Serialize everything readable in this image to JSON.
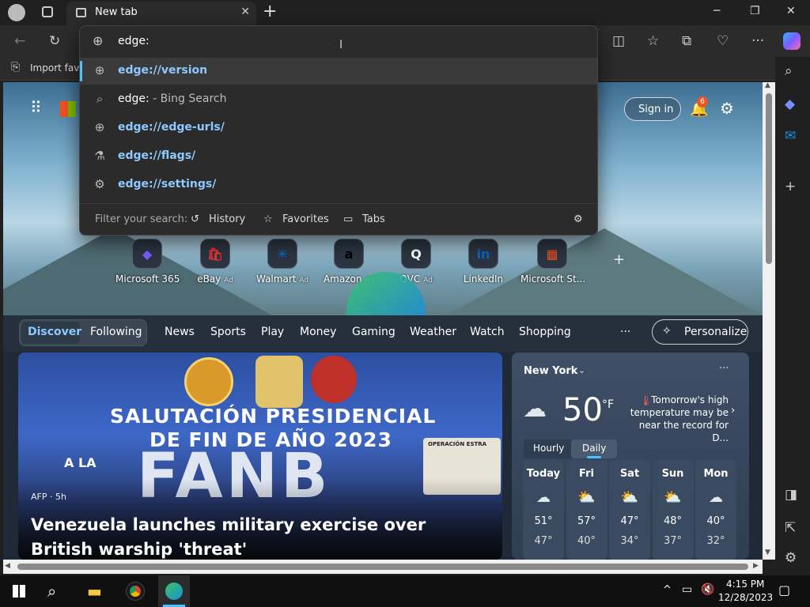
{
  "window": {
    "tab_title": "New tab",
    "minimize": "─",
    "restore": "❐",
    "close": "✕"
  },
  "toolbar": {
    "address_value": "edge:"
  },
  "favorites_bar": {
    "import_label": "Import favo"
  },
  "omnibox": {
    "suggestions": [
      {
        "icon": "globe-icon",
        "text": "edge://version",
        "kind": "link"
      },
      {
        "icon": "search-icon",
        "text": "edge:",
        "suffix": " - Bing Search",
        "kind": "search"
      },
      {
        "icon": "globe-icon",
        "text": "edge://edge-urls/",
        "kind": "link"
      },
      {
        "icon": "flask-icon",
        "text": "edge://flags/",
        "kind": "link"
      },
      {
        "icon": "gear-icon",
        "text": "edge://settings/",
        "kind": "link"
      }
    ],
    "filter_label": "Filter your search:",
    "filters": [
      "History",
      "Favorites",
      "Tabs"
    ]
  },
  "ntp": {
    "sign_in": "Sign in",
    "notifications_count": "6",
    "quick_links": [
      {
        "name": "Microsoft 365",
        "ad": "",
        "glyph": "◆",
        "color": "#7b5cff"
      },
      {
        "name": "eBay",
        "ad": "Ad",
        "glyph": "🛍",
        "color": "#e53238"
      },
      {
        "name": "Walmart",
        "ad": "Ad",
        "glyph": "✳",
        "color": "#0071ce"
      },
      {
        "name": "Amazon",
        "ad": "Ad",
        "glyph": "a",
        "color": "#000000"
      },
      {
        "name": "QVC",
        "ad": "Ad",
        "glyph": "Q",
        "color": "#ffffff"
      },
      {
        "name": "LinkedIn",
        "ad": "",
        "glyph": "in",
        "color": "#0a66c2"
      },
      {
        "name": "Microsoft St...",
        "ad": "",
        "glyph": "▦",
        "color": "#f25022"
      }
    ],
    "feed_tabs": [
      "Discover",
      "Following",
      "News",
      "Sports",
      "Play",
      "Money",
      "Gaming",
      "Weather",
      "Watch",
      "Shopping"
    ],
    "more": "···",
    "personalize": "Personalize",
    "article": {
      "banner_line1": "SALUTACIÓN PRESIDENCIAL",
      "banner_line2": "DE FIN DE AÑO 2023",
      "banner_line3": "A LA",
      "banner_big": "FANB",
      "sign_text": "OPERACIÓN ESTRA",
      "source": "AFP · 5h",
      "headline": "Venezuela launches military exercise over British warship 'threat'"
    },
    "weather": {
      "location": "New York",
      "temp": "50",
      "unit": "°F",
      "note": "Tomorrow's high temperature may be near the record for D...",
      "tabs": [
        "Hourly",
        "Daily"
      ],
      "days": [
        {
          "name": "Today",
          "icon": "cloud-icon",
          "hi": "51°",
          "lo": "47°"
        },
        {
          "name": "Fri",
          "icon": "partly-sunny-icon",
          "hi": "57°",
          "lo": "40°"
        },
        {
          "name": "Sat",
          "icon": "partly-sunny-icon",
          "hi": "47°",
          "lo": "34°"
        },
        {
          "name": "Sun",
          "icon": "partly-sunny-icon",
          "hi": "48°",
          "lo": "37°"
        },
        {
          "name": "Mon",
          "icon": "cloud-icon",
          "hi": "40°",
          "lo": "32°"
        }
      ]
    }
  },
  "taskbar": {
    "time": "4:15 PM",
    "date": "12/28/2023"
  }
}
